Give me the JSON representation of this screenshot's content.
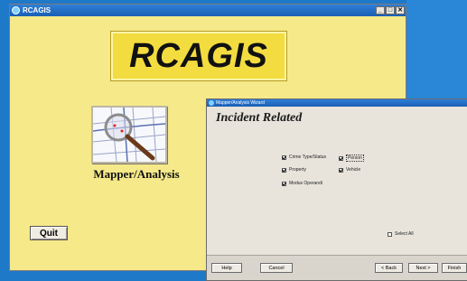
{
  "main_window": {
    "title": "RCAGIS",
    "controls": {
      "minimize": "_",
      "maximize": "□",
      "close": "✕"
    },
    "logo_text": "RCAGIS",
    "module_caption": "Mapper/Analysis",
    "quit_label": "Quit"
  },
  "wizard": {
    "title": "Mapper/Analysis Wizard",
    "heading": "Incident Related",
    "options": [
      {
        "label": "Crime Type/Status",
        "checked": true
      },
      {
        "label": "Person",
        "checked": true
      },
      {
        "label": "Property",
        "checked": true
      },
      {
        "label": "Vehicle",
        "checked": true
      },
      {
        "label": "Modus Operandi",
        "checked": true
      },
      {
        "label": "Select All",
        "checked": false
      }
    ],
    "buttons": {
      "help": "Help",
      "cancel": "Cancel",
      "back": "< Back",
      "next": "Next >",
      "finish": "Finish"
    }
  },
  "colors": {
    "desktop": "#1f79c9",
    "main_bg": "#f6e98a",
    "logo_bg": "#f3dc3f",
    "titlebar": "#1a5fb4",
    "wizard_bg": "#e8e4dc"
  }
}
